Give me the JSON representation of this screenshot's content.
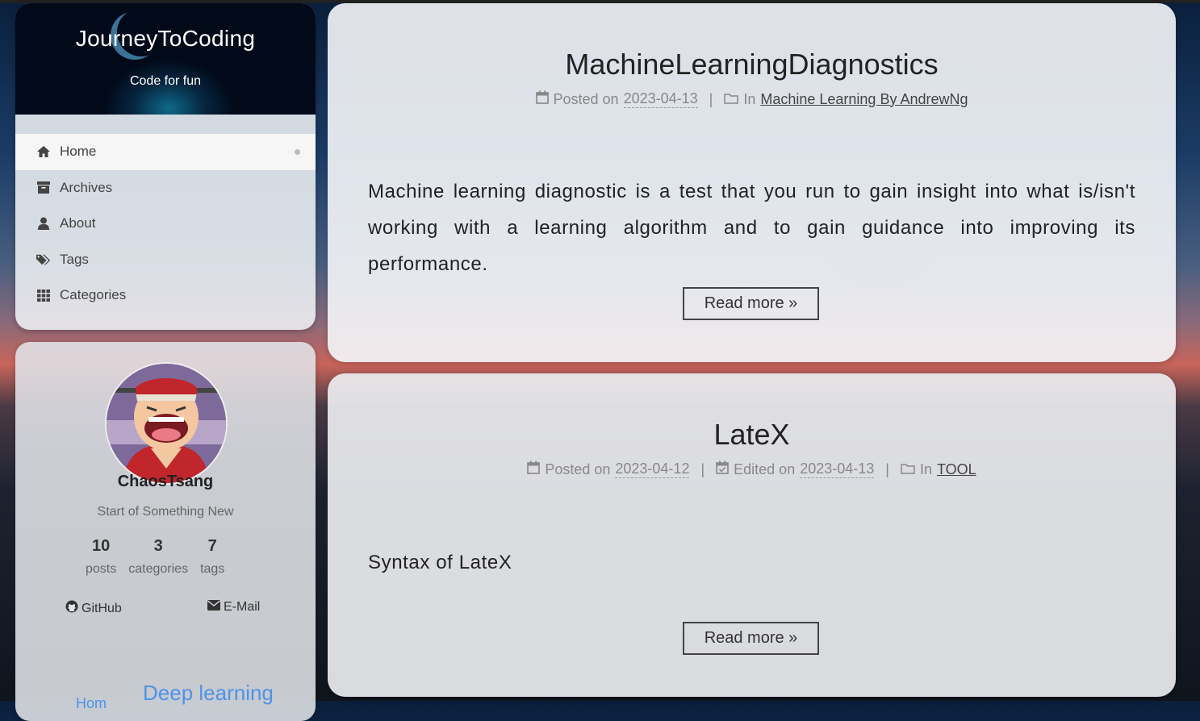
{
  "site": {
    "title": "JourneyToCoding",
    "subtitle": "Code for fun"
  },
  "menu": [
    {
      "label": "Home",
      "icon": "home-icon",
      "active": true
    },
    {
      "label": "Archives",
      "icon": "archive-icon"
    },
    {
      "label": "About",
      "icon": "user-icon"
    },
    {
      "label": "Tags",
      "icon": "tags-icon"
    },
    {
      "label": "Categories",
      "icon": "grid-icon"
    }
  ],
  "author": {
    "name": "ChaosTsang",
    "motto": "Start of Something New",
    "stats": [
      {
        "count": "10",
        "label": "posts"
      },
      {
        "count": "3",
        "label": "categories"
      },
      {
        "count": "7",
        "label": "tags"
      }
    ],
    "links": {
      "github": "GitHub",
      "email": "E-Mail"
    }
  },
  "sidebar_footer": {
    "text": "Deep learning",
    "partial": "Hom"
  },
  "posts": [
    {
      "title": "MachineLearningDiagnostics",
      "posted_label": "Posted on",
      "posted_date": "2023-04-13",
      "in_label": "In",
      "category": "Machine Learning By AndrewNg",
      "excerpt": "Machine learning diagnostic is a test that you run to gain insight into what is/isn't working with a learning algorithm and to gain guidance into improving its performance.",
      "read_more": "Read more »"
    },
    {
      "title": "LateX",
      "posted_label": "Posted on",
      "posted_date": "2023-04-12",
      "edited_label": "Edited on",
      "edited_date": "2023-04-13",
      "in_label": "In",
      "category": "TOOL",
      "excerpt": "Syntax of LateX",
      "read_more": "Read more »"
    }
  ],
  "separator": "|",
  "colors": {
    "accent": "#4c93e8",
    "brand_bg": "#062640"
  }
}
